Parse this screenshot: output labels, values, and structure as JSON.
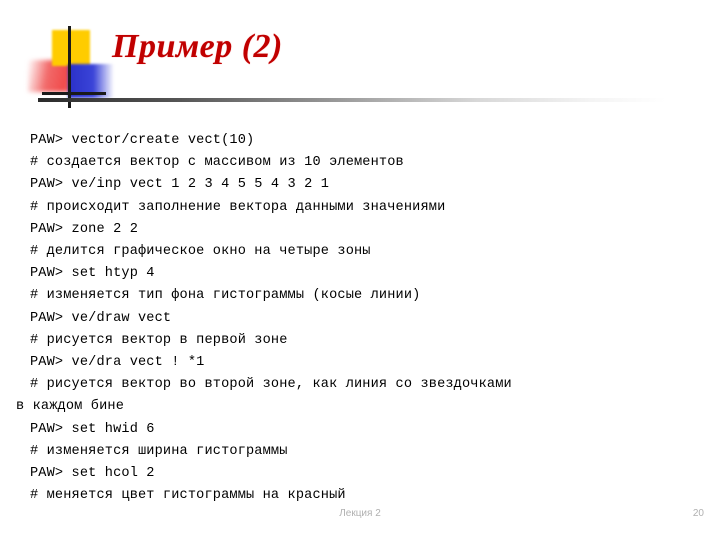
{
  "slide": {
    "title": "Пример (2)",
    "title_color": "#C00000",
    "logo": {
      "yellow": "#FFCC00",
      "red": "#F04A4A",
      "blue": "#2A30C8",
      "bar": "#1a1a1a"
    },
    "rule_color_start": "#2b2b2b",
    "rule_color_end": "#ffffff"
  },
  "console": {
    "lines": [
      {
        "text": "PAW> vector/create vect(10)",
        "hanging": false
      },
      {
        "text": "# создается вектор с массивом из 10 элементов",
        "hanging": false
      },
      {
        "text": "PAW> ve/inp vect 1 2 3 4 5 5 4 3 2 1",
        "hanging": false
      },
      {
        "text": "# происходит заполнение вектора данными значениями",
        "hanging": false
      },
      {
        "text": "PAW> zone 2 2",
        "hanging": false
      },
      {
        "text": "# делится графическое окно на четыре зоны",
        "hanging": false
      },
      {
        "text": "PAW> set htyp 4",
        "hanging": false
      },
      {
        "text": "# изменяется тип фона гистограммы (косые линии)",
        "hanging": false
      },
      {
        "text": "PAW> ve/draw vect",
        "hanging": false
      },
      {
        "text": "# рисуется вектор в первой зоне",
        "hanging": false
      },
      {
        "text": "PAW> ve/dra vect ! *1",
        "hanging": false
      },
      {
        "text": "# рисуется вектор во второй зоне, как линия со звездочками",
        "hanging": false
      },
      {
        "text": "в каждом бине",
        "hanging": true
      },
      {
        "text": "PAW> set hwid 6",
        "hanging": false
      },
      {
        "text": "# изменяется ширина гистограммы",
        "hanging": false
      },
      {
        "text": "PAW> set hcol 2",
        "hanging": false
      },
      {
        "text": "# меняется цвет гистограммы на красный",
        "hanging": false
      }
    ]
  },
  "footer": {
    "center_label": "Лекция 2",
    "page_number": "20"
  }
}
